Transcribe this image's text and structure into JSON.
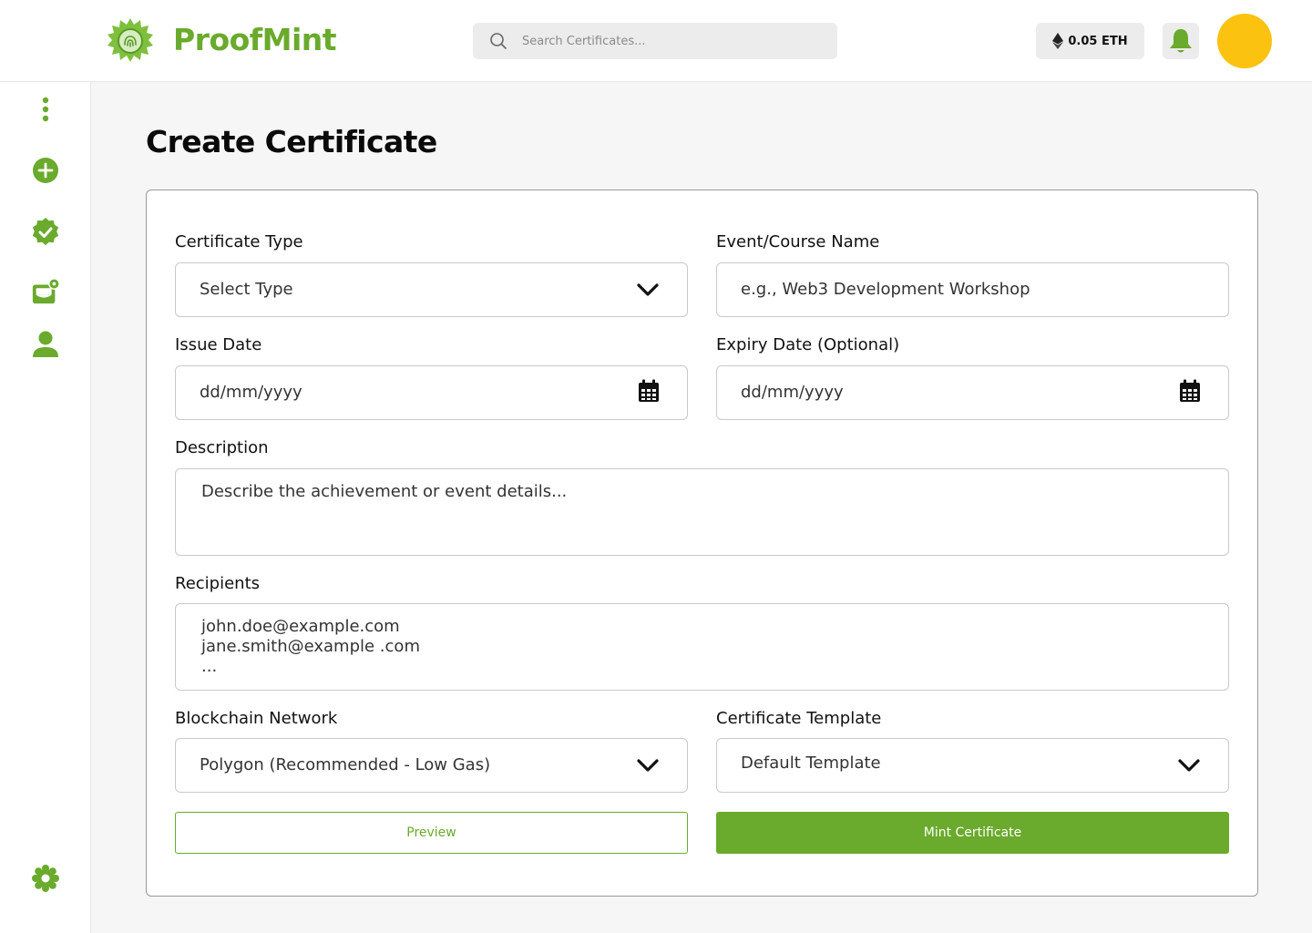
{
  "header": {
    "brand": "ProofMint",
    "search_placeholder": "Search Certificates...",
    "wallet_balance": "0.05 ETH",
    "accent_color": "#6aaa2c",
    "avatar_color": "#fbc210"
  },
  "sidebar": {
    "items": [
      {
        "icon": "more-vertical-icon"
      },
      {
        "icon": "add-circle-icon"
      },
      {
        "icon": "verified-badge-icon"
      },
      {
        "icon": "wallet-settings-icon"
      },
      {
        "icon": "user-icon"
      },
      {
        "icon": "settings-gear-icon"
      }
    ]
  },
  "main": {
    "title": "Create Certificate",
    "form": {
      "certificate_type": {
        "label": "Certificate Type",
        "value": "Select Type"
      },
      "event_name": {
        "label": "Event/Course Name",
        "placeholder": "e.g., Web3 Development Workshop"
      },
      "issue_date": {
        "label": "Issue Date",
        "placeholder": "dd/mm/yyyy"
      },
      "expiry_date": {
        "label": "Expiry Date (Optional)",
        "placeholder": "dd/mm/yyyy"
      },
      "description": {
        "label": "Description",
        "placeholder": "Describe the achievement or event details..."
      },
      "recipients": {
        "label": "Recipients",
        "lines": [
          "john.doe@example.com",
          "jane.smith@example .com",
          "..."
        ]
      },
      "network": {
        "label": "Blockchain Network",
        "value": "Polygon (Recommended - Low Gas)"
      },
      "template": {
        "label": "Certificate Template",
        "value": "Default Template"
      },
      "preview_label": "Preview",
      "mint_label": "Mint Certificate"
    }
  }
}
